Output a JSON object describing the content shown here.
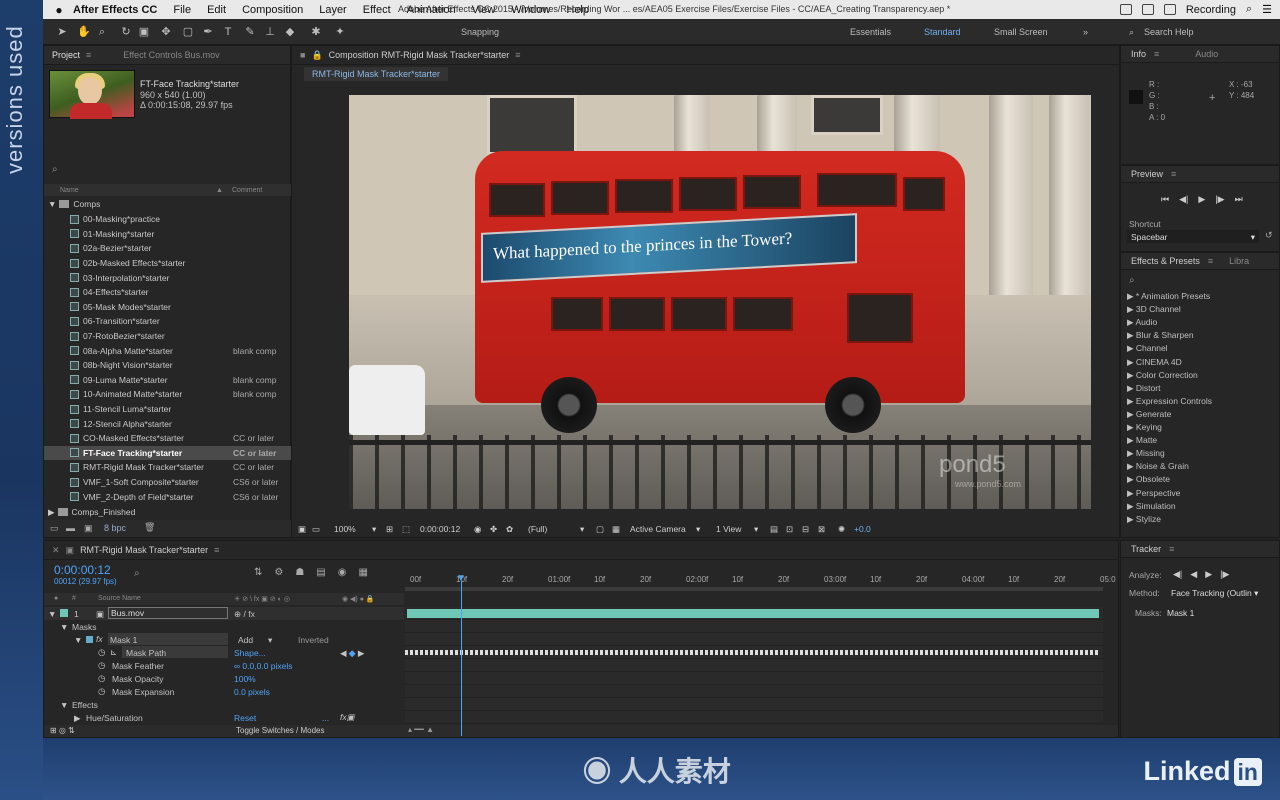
{
  "side_label": "versions used",
  "menubar": {
    "app": "After Effects CC",
    "items": [
      "File",
      "Edit",
      "Composition",
      "Layer",
      "Effect",
      "Animation",
      "View",
      "Window",
      "Help"
    ],
    "doc_title": "Adobe After Effects CC 2015 - /Volumes/Recording Wor ... es/AEA05 Exercise Files/Exercise Files - CC/AEA_Creating Transparency.aep *",
    "recording": "Recording"
  },
  "toolbar": {
    "snapping": "Snapping",
    "workspaces": [
      "Essentials",
      "Standard",
      "Small Screen"
    ],
    "active_workspace": "Standard",
    "search_help": "Search Help"
  },
  "project": {
    "tab": "Project",
    "effect_controls": "Effect Controls Bus.mov",
    "item_name": "FT-Face Tracking*starter",
    "item_dims": "960 x 540 (1.00)",
    "item_duration": "Δ 0:00:15:08, 29.97 fps",
    "col_name": "Name",
    "col_comment": "Comment",
    "folder": "Comps",
    "items": [
      {
        "name": "00-Masking*practice",
        "comment": ""
      },
      {
        "name": "01-Masking*starter",
        "comment": ""
      },
      {
        "name": "02a-Bezier*starter",
        "comment": ""
      },
      {
        "name": "02b-Masked Effects*starter",
        "comment": ""
      },
      {
        "name": "03-Interpolation*starter",
        "comment": ""
      },
      {
        "name": "04-Effects*starter",
        "comment": ""
      },
      {
        "name": "05-Mask Modes*starter",
        "comment": ""
      },
      {
        "name": "06-Transition*starter",
        "comment": ""
      },
      {
        "name": "07-RotoBezier*starter",
        "comment": ""
      },
      {
        "name": "08a-Alpha Matte*starter",
        "comment": "blank comp"
      },
      {
        "name": "08b-Night Vision*starter",
        "comment": ""
      },
      {
        "name": "09-Luma Matte*starter",
        "comment": "blank comp"
      },
      {
        "name": "10-Animated Matte*starter",
        "comment": "blank comp"
      },
      {
        "name": "11-Stencil Luma*starter",
        "comment": ""
      },
      {
        "name": "12-Stencil Alpha*starter",
        "comment": ""
      },
      {
        "name": "CO-Masked Effects*starter",
        "comment": "CC or later"
      },
      {
        "name": "FT-Face Tracking*starter",
        "comment": "CC or later"
      },
      {
        "name": "RMT-Rigid Mask Tracker*starter",
        "comment": "CC or later"
      },
      {
        "name": "VMF_1-Soft Composite*starter",
        "comment": "CS6 or later"
      },
      {
        "name": "VMF_2-Depth of Field*starter",
        "comment": "CS6 or later"
      }
    ],
    "selected_index": 16,
    "folder2": "Comps_Finished",
    "bpc": "8 bpc"
  },
  "viewer": {
    "tab": "Composition RMT-Rigid Mask Tracker*starter",
    "subtab": "RMT-Rigid Mask Tracker*starter",
    "ad_text": "What happened to the princes in the Tower?",
    "watermark": "pond5",
    "watermark_url": "www.pond5.com",
    "zoom": "100%",
    "timecode": "0:00:00:12",
    "resolution": "(Full)",
    "camera": "Active Camera",
    "view": "1 View",
    "exposure": "+0.0"
  },
  "info": {
    "tabs": [
      "Info",
      "Audio"
    ],
    "rgba": [
      "R :",
      "G :",
      "B :",
      "A : 0"
    ],
    "x": "X : -63",
    "y": "Y : 484"
  },
  "preview": {
    "title": "Preview",
    "shortcut_label": "Shortcut",
    "shortcut": "Spacebar"
  },
  "effects": {
    "tabs": [
      "Effects & Presets",
      "Libra"
    ],
    "items": [
      "* Animation Presets",
      "3D Channel",
      "Audio",
      "Blur & Sharpen",
      "Channel",
      "CINEMA 4D",
      "Color Correction",
      "Distort",
      "Expression Controls",
      "Generate",
      "Keying",
      "Matte",
      "Missing",
      "Noise & Grain",
      "Obsolete",
      "Perspective",
      "Simulation",
      "Stylize"
    ]
  },
  "timeline": {
    "tab": "RMT-Rigid Mask Tracker*starter",
    "timecode": "0:00:00:12",
    "frames": "00012 (29.97 fps)",
    "col_source": "Source Name",
    "ticks": [
      "00f",
      "10f",
      "20f",
      "01:00f",
      "10f",
      "20f",
      "02:00f",
      "10f",
      "20f",
      "03:00f",
      "10f",
      "20f",
      "04:00f",
      "10f",
      "20f",
      "05:0"
    ],
    "layer_num": "1",
    "layer": "Bus.mov",
    "masks": "Masks",
    "mask1": "Mask 1",
    "mode": "Add",
    "inverted": "Inverted",
    "mask_path": "Mask Path",
    "mask_path_val": "Shape...",
    "mask_feather": "Mask Feather",
    "mask_feather_val": "0.0,0.0 pixels",
    "mask_opacity": "Mask Opacity",
    "mask_opacity_val": "100%",
    "mask_expansion": "Mask Expansion",
    "mask_expansion_val": "0.0 pixels",
    "effects": "Effects",
    "hue": "Hue/Saturation",
    "reset": "Reset",
    "toggle": "Toggle Switches / Modes"
  },
  "tracker": {
    "title": "Tracker",
    "analyze": "Analyze:",
    "method_label": "Method:",
    "method": "Face Tracking (Outlin",
    "masks_label": "Masks:",
    "masks": "Mask 1"
  },
  "brand": {
    "linkedin": "Linked",
    "in": "in",
    "cn": "人人素材"
  }
}
